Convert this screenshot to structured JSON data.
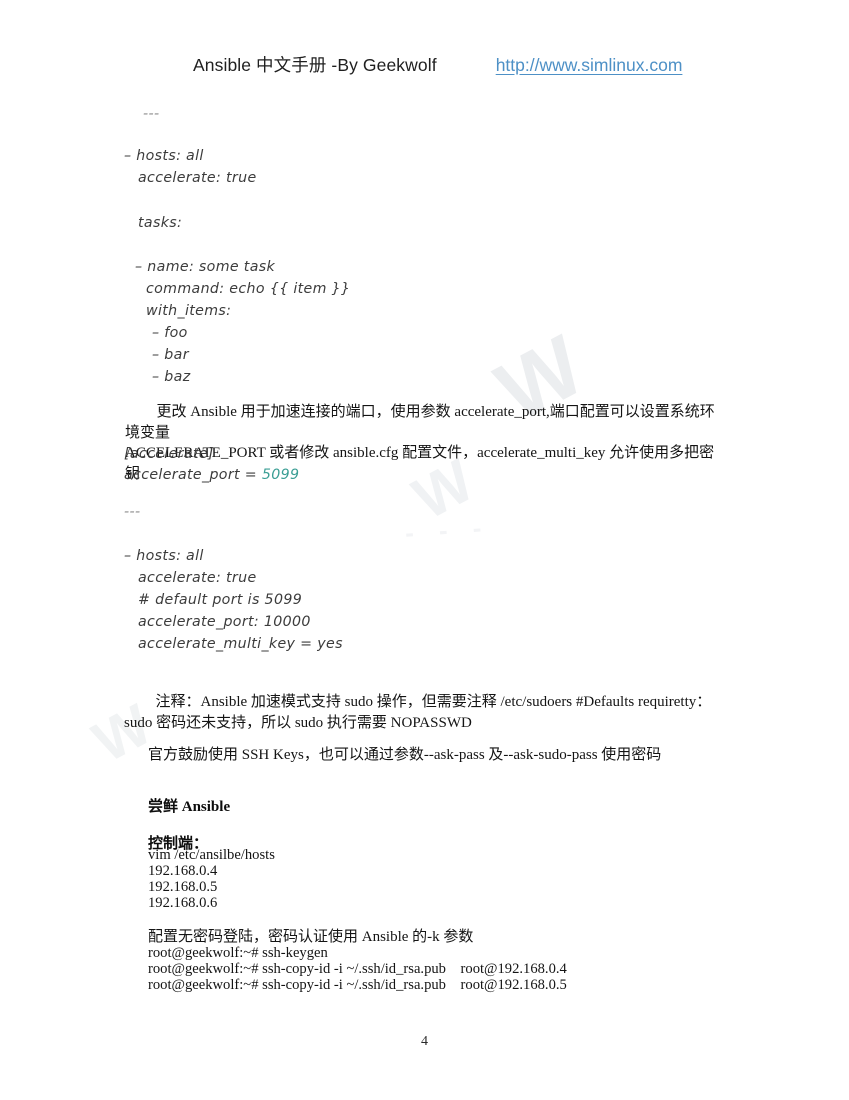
{
  "header": {
    "title": "Ansible 中文手册  -By Geekwolf",
    "link": "http://www.simlinux.com",
    "link_color": "#4d90c6"
  },
  "watermark": {
    "mark1": "W",
    "mark2": "W",
    "mark3": "- - -",
    "mark4": "W"
  },
  "code_block_1": {
    "line_dashes": "---",
    "line_hosts": "– hosts: all",
    "line_accelerate": "accelerate: true",
    "line_tasks": "tasks:",
    "line_name": "– name: some task",
    "line_command": "command: echo {{ item }}",
    "line_with_items": "with_items:",
    "line_foo": "– foo",
    "line_bar": "– bar",
    "line_baz": "– baz"
  },
  "paragraph_accelerate_port": {
    "line1": "更改 Ansible 用于加速连接的端口，使用参数 accelerate_port,端口配置可以设置系统环境变量",
    "line2": "ACCELERATE_PORT 或者修改 ansible.cfg 配置文件，accelerate_multi_key 允许使用多把密钥"
  },
  "config_snippet": {
    "section": "[accelerate]",
    "key": "accelerate_port = ",
    "value": "5099",
    "value_color": "#3a9e94"
  },
  "code_block_2": {
    "line_dashes": "---",
    "line_hosts": "– hosts: all",
    "line_accelerate": "accelerate: true",
    "line_comment": "# default port is 5099",
    "line_port": "accelerate_port: 10000",
    "line_multi_key": "accelerate_multi_key = yes"
  },
  "note_block": {
    "line1": "注释：Ansible 加速模式支持 sudo 操作，但需要注释 /etc/sudoers   #Defaults       requiretty：",
    "line2": "sudo 密码还未支持，所以 sudo 执行需要 NOPASSWD",
    "line3": "官方鼓励使用 SSH Keys，也可以通过参数--ask-pass 及--ask-sudo-pass 使用密码"
  },
  "section_taste": {
    "heading": "尝鲜 Ansible",
    "sub_heading": "控制端：",
    "cmd_vim": "vim /etc/ansilbe/hosts",
    "host1": "192.168.0.4",
    "host2": "192.168.0.5",
    "host3": "192.168.0.6"
  },
  "section_keys": {
    "desc": "配置无密码登陆，密码认证使用 Ansible 的-k 参数",
    "cmd_keygen": "root@geekwolf:~# ssh-keygen",
    "cmd_copyid1": "root@geekwolf:~# ssh-copy-id -i ~/.ssh/id_rsa.pub    root@192.168.0.4",
    "cmd_copyid2": "root@geekwolf:~# ssh-copy-id -i ~/.ssh/id_rsa.pub    root@192.168.0.5"
  },
  "footer": {
    "page_number": "4"
  }
}
